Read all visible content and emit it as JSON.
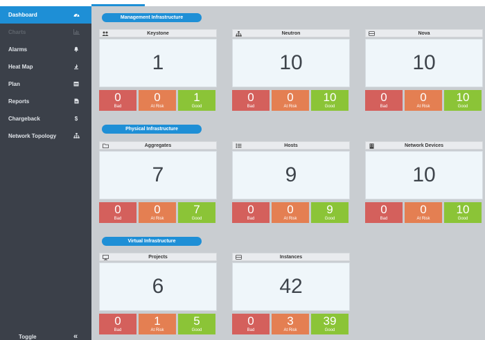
{
  "sidebar": {
    "items": [
      {
        "label": "Dashboard",
        "icon": "dashboard-gauge"
      },
      {
        "label": "Charts",
        "icon": "chart-bars"
      },
      {
        "label": "Alarms",
        "icon": "bell"
      },
      {
        "label": "Heat Map",
        "icon": "flame"
      },
      {
        "label": "Plan",
        "icon": "calendar"
      },
      {
        "label": "Reports",
        "icon": "report"
      },
      {
        "label": "Chargeback",
        "icon": "dollar",
        "glyph": "$"
      },
      {
        "label": "Network Topology",
        "icon": "topology"
      }
    ],
    "toggle": {
      "label": "Toggle",
      "glyph": "«"
    }
  },
  "sections": {
    "management": "Management Infrastructure",
    "physical": "Physical Infrastructure",
    "virtual": "Virtual Infrastructure"
  },
  "cards": [
    {
      "title": "Keystone",
      "icon": "users",
      "total": "1",
      "bad": "0",
      "risk": "0",
      "good": "1"
    },
    {
      "title": "Neutron",
      "icon": "sitemap",
      "total": "10",
      "bad": "0",
      "risk": "0",
      "good": "10"
    },
    {
      "title": "Nova",
      "icon": "server",
      "total": "10",
      "bad": "0",
      "risk": "0",
      "good": "10"
    },
    {
      "title": "Aggregates",
      "icon": "folder",
      "total": "7",
      "bad": "0",
      "risk": "0",
      "good": "7"
    },
    {
      "title": "Hosts",
      "icon": "list",
      "total": "9",
      "bad": "0",
      "risk": "0",
      "good": "9"
    },
    {
      "title": "Network Devices",
      "icon": "building",
      "total": "10",
      "bad": "0",
      "risk": "0",
      "good": "10"
    },
    {
      "title": "Projects",
      "icon": "monitor",
      "total": "6",
      "bad": "0",
      "risk": "1",
      "good": "5"
    },
    {
      "title": "Instances",
      "icon": "server",
      "total": "42",
      "bad": "0",
      "risk": "3",
      "good": "39"
    }
  ],
  "stat_labels": {
    "bad": "Bad",
    "risk": "At Risk",
    "good": "Good"
  },
  "colors": {
    "accent": "#1e8fd6",
    "bad": "#d4605c",
    "risk": "#e47f52",
    "good": "#8bc437",
    "sidebar": "#3b4049"
  }
}
